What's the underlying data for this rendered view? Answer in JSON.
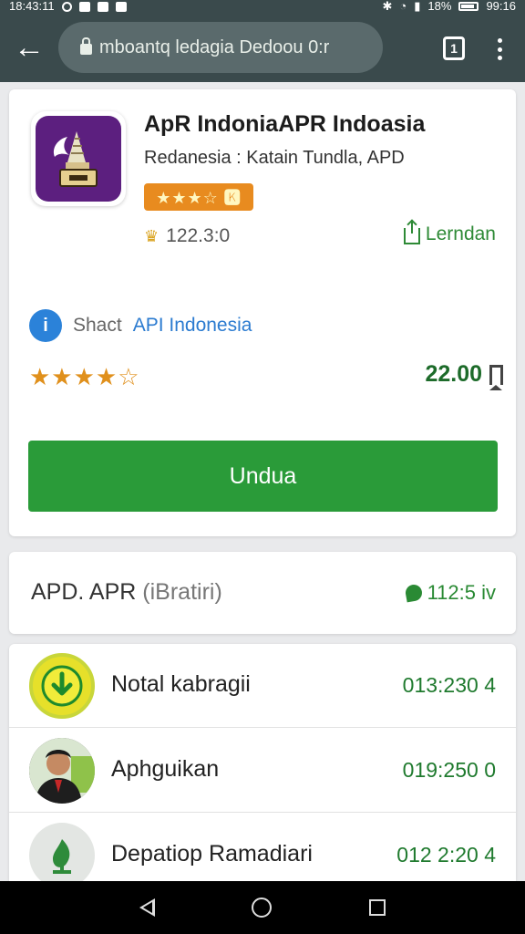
{
  "status_bar": {
    "time": "18:43:11",
    "battery": "18%",
    "clock_right": "99:16"
  },
  "toolbar": {
    "url": "mboantq ledagia Dedoou 0:r",
    "tabs_count": "1"
  },
  "app": {
    "title": "ApR IndoniaAPR Indoasia",
    "subtitle": "Redanesia : Katain Tundla, APD",
    "rating_badge": "★★★☆ 🅺",
    "downloads": "122.3:0",
    "download_link": "Lerndan",
    "developer_prefix": "Shact",
    "developer_link": "API Indonesia",
    "stars": "★★★★☆",
    "price": "22.00",
    "install_label": "Undua"
  },
  "category": {
    "title": "APD. APR",
    "subtitle": "(iBratiri)",
    "meta": "112:5 iv"
  },
  "list": [
    {
      "name": "Notal kabragii",
      "value": "013:230 4",
      "icon": "download-arrow-icon"
    },
    {
      "name": "Aphguikan",
      "value": "019:250 0",
      "icon": "person-avatar"
    },
    {
      "name": "Depatiop Ramadiari",
      "value": "012 2:20 4",
      "icon": "leaf-icon"
    }
  ],
  "colors": {
    "toolbar": "#3a4a4c",
    "accent_green": "#2a9b39",
    "link_blue": "#2b7bd0",
    "app_icon_purple": "#5c1f7f",
    "badge_orange": "#e88b1f"
  }
}
